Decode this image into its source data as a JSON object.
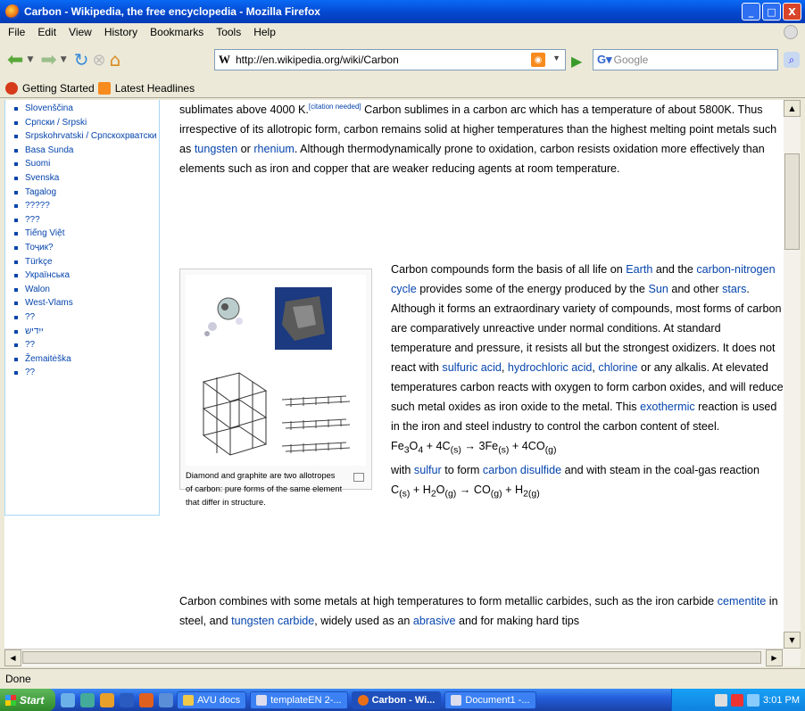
{
  "window": {
    "title": "Carbon - Wikipedia, the free encyclopedia - Mozilla Firefox",
    "controls": [
      "_",
      "□",
      "X"
    ]
  },
  "menu": [
    "File",
    "Edit",
    "View",
    "History",
    "Bookmarks",
    "Tools",
    "Help"
  ],
  "nav": {
    "url": "http://en.wikipedia.org/wiki/Carbon",
    "search_placeholder": "Google",
    "url_icon": "W"
  },
  "bookmarks": [
    "Getting Started",
    "Latest Headlines"
  ],
  "languages": [
    "Slovenščina",
    "Српски / Srpski",
    "Srpskohrvatski / Српскохрватски",
    "Basa Sunda",
    "Suomi",
    "Svenska",
    "Tagalog",
    "?????",
    "???",
    "Tiếng Việt",
    "Тоҷик?",
    "Türkçe",
    "Українська",
    "Walon",
    "West-Vlams",
    "??",
    "ייִדיש",
    "??",
    "Žemaitėška",
    "??"
  ],
  "article": {
    "p1": {
      "t1": "sublimates above 4000 K.",
      "cite": "[citation needed]",
      "t2": " Carbon sublimes in a carbon arc which has a temperature of about 5800K. Thus irrespective of its allotropic form, carbon remains solid at higher temperatures than the highest melting point metals such as ",
      "l1": "tungsten",
      "t3": " or ",
      "l2": "rhenium",
      "t4": ". Although thermodynamically prone to oxidation, carbon resists oxidation more effectively than elements such as iron and copper that are weaker reducing agents at room temperature."
    },
    "p2": {
      "t1": "Carbon compounds form the basis of all life on ",
      "l1": "Earth",
      "t2": " and the ",
      "l2": "carbon-nitrogen cycle",
      "t3": " provides some of the energy produced by the ",
      "l3": "Sun",
      "t4": " and other ",
      "l4": "stars",
      "t5": ". Although it forms an extraordinary variety of compounds, most forms of carbon are comparatively unreactive under normal conditions. At standard temperature and pressure, it resists all but the strongest oxidizers. It does not react with ",
      "l5": "sulfuric acid",
      "t6": ", ",
      "l6": "hydrochloric acid",
      "t7": ", ",
      "l7": "chlorine",
      "t8": " or any alkalis. At elevated temperatures carbon reacts with oxygen to form carbon oxides, and will reduce such metal oxides as iron oxide to the metal. This ",
      "l8": "exothermic",
      "t9": " reaction is used in the iron and steel industry to control the carbon content of steel."
    },
    "eq1": {
      "a": "Fe",
      "a1": "3",
      "b": "O",
      "b1": "4",
      "c": " + 4C",
      "c1": "(s)",
      "d": " → 3Fe",
      "d1": "(s)",
      "e": " + 4CO",
      "e1": "(g)"
    },
    "p3": {
      "t1": "with ",
      "l1": "sulfur",
      "t2": " to form ",
      "l2": "carbon disulfide",
      "t3": " and with steam in the coal-gas reaction"
    },
    "eq2": {
      "a": "C",
      "a1": "(s)",
      "b": " + H",
      "b1": "2",
      "c": "O",
      "c1": "(g)",
      "d": " → CO",
      "d1": "(g)",
      "e": " + H",
      "e1": "2(g)"
    },
    "p4": {
      "t1": "Carbon combines with some metals at high temperatures to form metallic carbides, such as the iron carbide ",
      "l1": "cementite",
      "t2": " in steel, and ",
      "l2": "tungsten carbide",
      "t3": ", widely used as an ",
      "l3": "abrasive",
      "t4": " and for making hard tips"
    },
    "caption": "Diamond and graphite are two allotropes of carbon: pure forms of the same element that differ in structure."
  },
  "status": "Done",
  "taskbar": {
    "start": "Start",
    "tasks": [
      "AVU docs",
      "templateEN 2-...",
      "Carbon - Wi...",
      "Document1 -..."
    ],
    "active": 2,
    "time": "3:01 PM"
  }
}
